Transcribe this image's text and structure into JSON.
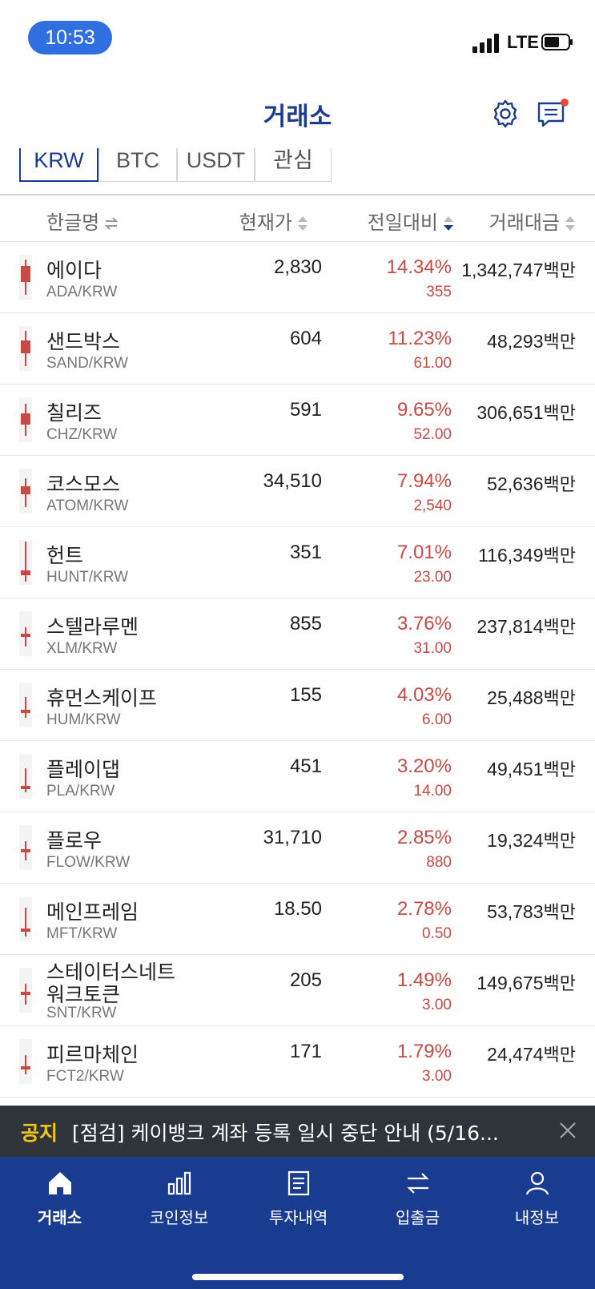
{
  "status": {
    "time": "10:53",
    "network": "LTE"
  },
  "header": {
    "title": "거래소"
  },
  "tabs": [
    {
      "label": "KRW",
      "active": true
    },
    {
      "label": "BTC",
      "active": false
    },
    {
      "label": "USDT",
      "active": false
    },
    {
      "label": "관심",
      "active": false
    }
  ],
  "columns": {
    "name": "한글명",
    "price": "현재가",
    "change": "전일대비",
    "volume": "거래대금"
  },
  "rows": [
    {
      "name": "에이다",
      "symbol": "ADA/KRW",
      "price": "2,830",
      "pct": "14.34%",
      "diff": "355",
      "volume": "1,342,747",
      "unit": "백만"
    },
    {
      "name": "샌드박스",
      "symbol": "SAND/KRW",
      "price": "604",
      "pct": "11.23%",
      "diff": "61.00",
      "volume": "48,293",
      "unit": "백만"
    },
    {
      "name": "칠리즈",
      "symbol": "CHZ/KRW",
      "price": "591",
      "pct": "9.65%",
      "diff": "52.00",
      "volume": "306,651",
      "unit": "백만"
    },
    {
      "name": "코스모스",
      "symbol": "ATOM/KRW",
      "price": "34,510",
      "pct": "7.94%",
      "diff": "2,540",
      "volume": "52,636",
      "unit": "백만"
    },
    {
      "name": "헌트",
      "symbol": "HUNT/KRW",
      "price": "351",
      "pct": "7.01%",
      "diff": "23.00",
      "volume": "116,349",
      "unit": "백만"
    },
    {
      "name": "스텔라루멘",
      "symbol": "XLM/KRW",
      "price": "855",
      "pct": "3.76%",
      "diff": "31.00",
      "volume": "237,814",
      "unit": "백만"
    },
    {
      "name": "휴먼스케이프",
      "symbol": "HUM/KRW",
      "price": "155",
      "pct": "4.03%",
      "diff": "6.00",
      "volume": "25,488",
      "unit": "백만"
    },
    {
      "name": "플레이댑",
      "symbol": "PLA/KRW",
      "price": "451",
      "pct": "3.20%",
      "diff": "14.00",
      "volume": "49,451",
      "unit": "백만"
    },
    {
      "name": "플로우",
      "symbol": "FLOW/KRW",
      "price": "31,710",
      "pct": "2.85%",
      "diff": "880",
      "volume": "19,324",
      "unit": "백만"
    },
    {
      "name": "메인프레임",
      "symbol": "MFT/KRW",
      "price": "18.50",
      "pct": "2.78%",
      "diff": "0.50",
      "volume": "53,783",
      "unit": "백만"
    },
    {
      "name": "스테이터스네트",
      "name2": "워크토큰",
      "symbol": "SNT/KRW",
      "price": "205",
      "pct": "1.49%",
      "diff": "3.00",
      "volume": "149,675",
      "unit": "백만"
    },
    {
      "name": "피르마체인",
      "symbol": "FCT2/KRW",
      "price": "171",
      "pct": "1.79%",
      "diff": "3.00",
      "volume": "24,474",
      "unit": "백만"
    }
  ],
  "notice": {
    "label": "공지",
    "text": "[점검] 케이뱅크 계좌 등록 일시 중단 안내 (5/16..."
  },
  "nav": [
    {
      "label": "거래소",
      "icon": "home-icon",
      "active": true
    },
    {
      "label": "코인정보",
      "icon": "bar-chart-icon",
      "active": false
    },
    {
      "label": "투자내역",
      "icon": "document-icon",
      "active": false
    },
    {
      "label": "입출금",
      "icon": "transfer-icon",
      "active": false
    },
    {
      "label": "내정보",
      "icon": "user-icon",
      "active": false
    }
  ],
  "colors": {
    "brand": "#1d3c8f",
    "rise": "#c84a44",
    "nav_bg": "#1a3c90",
    "notice_bg": "#2f343a"
  }
}
